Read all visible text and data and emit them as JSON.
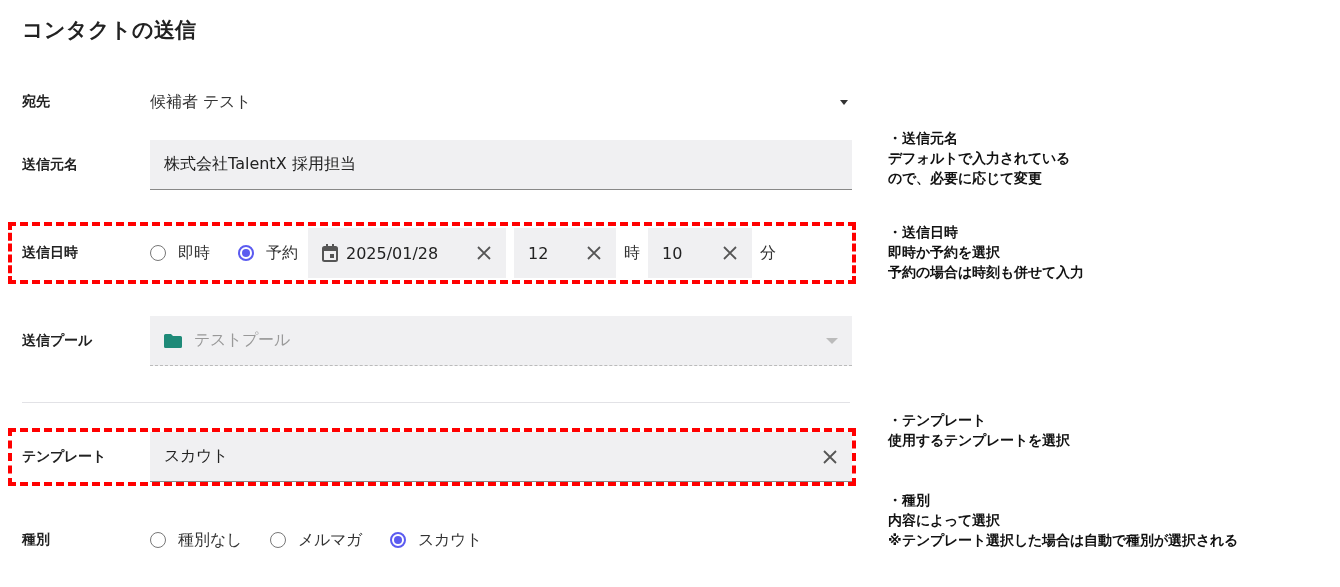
{
  "title": "コンタクトの送信",
  "fields": [
    {
      "kind": "select",
      "label": "宛先",
      "value": "候補者 テスト",
      "highlighted": false
    },
    {
      "kind": "text",
      "label": "送信元名",
      "value": "株式会社TalentX 採用担当",
      "highlighted": false,
      "note": [
        "・送信元名",
        "デフォルトで入力されている",
        "ので、必要に応じて変更"
      ]
    },
    {
      "kind": "schedule",
      "label": "送信日時",
      "highlighted": true,
      "options": [
        {
          "label": "即時",
          "selected": false
        },
        {
          "label": "予約",
          "selected": true
        }
      ],
      "date": "2025/01/28",
      "hour": "12",
      "hour_unit": "時",
      "minute": "10",
      "minute_unit": "分",
      "note": [
        "・送信日時",
        "即時か予約を選択",
        "予約の場合は時刻も併せて入力"
      ]
    },
    {
      "kind": "pool",
      "label": "送信プール",
      "value": "テストプール",
      "disabled": true,
      "highlighted": false
    },
    {
      "kind": "template",
      "label": "テンプレート",
      "value": "スカウト",
      "highlighted": true,
      "divider_before": true,
      "note": [
        "・テンプレート",
        "使用するテンプレートを選択"
      ]
    },
    {
      "kind": "radio",
      "label": "種別",
      "highlighted": false,
      "options": [
        {
          "label": "種別なし",
          "selected": false
        },
        {
          "label": "メルマガ",
          "selected": false
        },
        {
          "label": "スカウト",
          "selected": true
        }
      ],
      "note": [
        "・種別",
        "内容によって選択",
        "※テンプレート選択した場合は自動で種別が選択される"
      ]
    }
  ]
}
